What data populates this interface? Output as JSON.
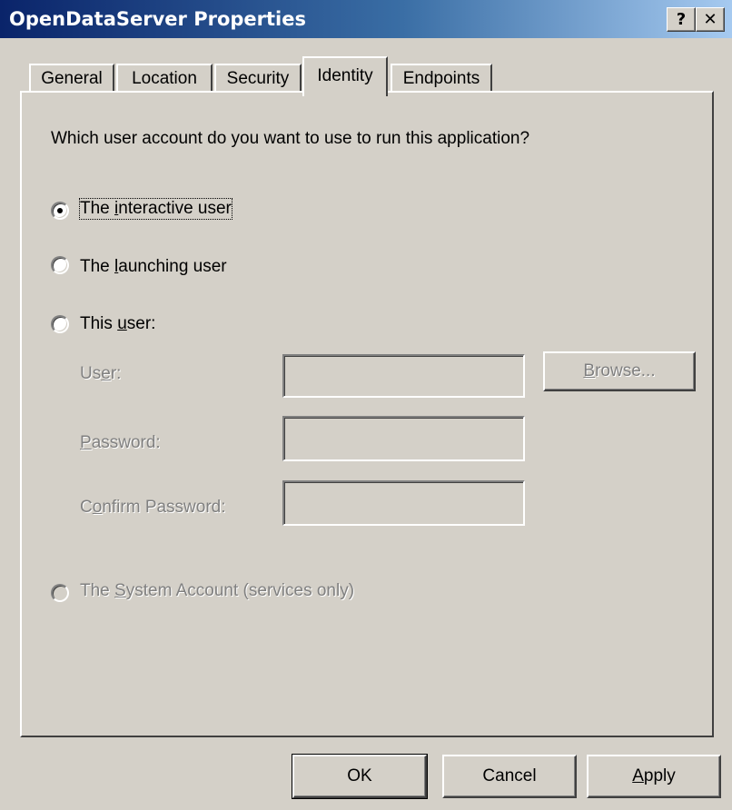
{
  "window": {
    "title": "OpenDataServer Properties",
    "help_button": "?",
    "close_button": "✕"
  },
  "tabs": [
    {
      "label": "General",
      "active": false
    },
    {
      "label": "Location",
      "active": false
    },
    {
      "label": "Security",
      "active": false
    },
    {
      "label": "Identity",
      "active": true
    },
    {
      "label": "Endpoints",
      "active": false
    }
  ],
  "identity": {
    "question": "Which user account do you want to use to run this application?",
    "options": [
      {
        "pre": "The ",
        "key": "i",
        "post": "nteractive user",
        "selected": true,
        "enabled": true
      },
      {
        "pre": "The ",
        "key": "l",
        "post": "aunching user",
        "selected": false,
        "enabled": true
      },
      {
        "pre": "This ",
        "key": "u",
        "post": "ser:",
        "selected": false,
        "enabled": true
      },
      {
        "pre": "The ",
        "key": "S",
        "post": "ystem Account (services only)",
        "selected": false,
        "enabled": false
      }
    ],
    "user_label": {
      "pre": "Us",
      "key": "e",
      "post": "r:"
    },
    "user_value": "",
    "password_label": {
      "pre": "",
      "key": "P",
      "post": "assword:"
    },
    "password_value": "",
    "confirm_label": {
      "pre": "C",
      "key": "o",
      "post": "nfirm Password:"
    },
    "confirm_value": "",
    "browse_button": {
      "pre": "",
      "key": "B",
      "post": "rowse..."
    }
  },
  "buttons": {
    "ok": "OK",
    "cancel": "Cancel",
    "apply": {
      "pre": "",
      "key": "A",
      "post": "pply"
    }
  }
}
